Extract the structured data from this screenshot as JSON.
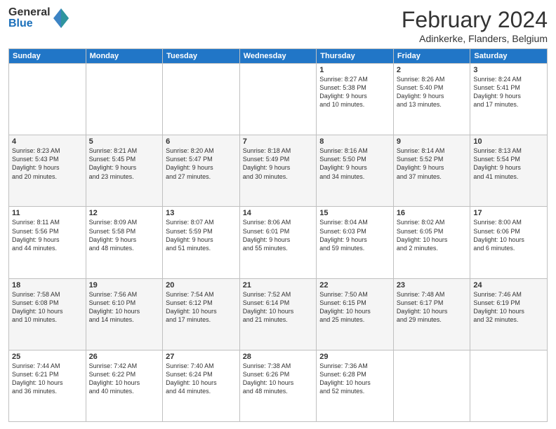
{
  "header": {
    "logo": {
      "general": "General",
      "blue": "Blue"
    },
    "title": "February 2024",
    "location": "Adinkerke, Flanders, Belgium"
  },
  "weekdays": [
    "Sunday",
    "Monday",
    "Tuesday",
    "Wednesday",
    "Thursday",
    "Friday",
    "Saturday"
  ],
  "weeks": [
    [
      {
        "day": "",
        "info": ""
      },
      {
        "day": "",
        "info": ""
      },
      {
        "day": "",
        "info": ""
      },
      {
        "day": "",
        "info": ""
      },
      {
        "day": "1",
        "info": "Sunrise: 8:27 AM\nSunset: 5:38 PM\nDaylight: 9 hours\nand 10 minutes."
      },
      {
        "day": "2",
        "info": "Sunrise: 8:26 AM\nSunset: 5:40 PM\nDaylight: 9 hours\nand 13 minutes."
      },
      {
        "day": "3",
        "info": "Sunrise: 8:24 AM\nSunset: 5:41 PM\nDaylight: 9 hours\nand 17 minutes."
      }
    ],
    [
      {
        "day": "4",
        "info": "Sunrise: 8:23 AM\nSunset: 5:43 PM\nDaylight: 9 hours\nand 20 minutes."
      },
      {
        "day": "5",
        "info": "Sunrise: 8:21 AM\nSunset: 5:45 PM\nDaylight: 9 hours\nand 23 minutes."
      },
      {
        "day": "6",
        "info": "Sunrise: 8:20 AM\nSunset: 5:47 PM\nDaylight: 9 hours\nand 27 minutes."
      },
      {
        "day": "7",
        "info": "Sunrise: 8:18 AM\nSunset: 5:49 PM\nDaylight: 9 hours\nand 30 minutes."
      },
      {
        "day": "8",
        "info": "Sunrise: 8:16 AM\nSunset: 5:50 PM\nDaylight: 9 hours\nand 34 minutes."
      },
      {
        "day": "9",
        "info": "Sunrise: 8:14 AM\nSunset: 5:52 PM\nDaylight: 9 hours\nand 37 minutes."
      },
      {
        "day": "10",
        "info": "Sunrise: 8:13 AM\nSunset: 5:54 PM\nDaylight: 9 hours\nand 41 minutes."
      }
    ],
    [
      {
        "day": "11",
        "info": "Sunrise: 8:11 AM\nSunset: 5:56 PM\nDaylight: 9 hours\nand 44 minutes."
      },
      {
        "day": "12",
        "info": "Sunrise: 8:09 AM\nSunset: 5:58 PM\nDaylight: 9 hours\nand 48 minutes."
      },
      {
        "day": "13",
        "info": "Sunrise: 8:07 AM\nSunset: 5:59 PM\nDaylight: 9 hours\nand 51 minutes."
      },
      {
        "day": "14",
        "info": "Sunrise: 8:06 AM\nSunset: 6:01 PM\nDaylight: 9 hours\nand 55 minutes."
      },
      {
        "day": "15",
        "info": "Sunrise: 8:04 AM\nSunset: 6:03 PM\nDaylight: 9 hours\nand 59 minutes."
      },
      {
        "day": "16",
        "info": "Sunrise: 8:02 AM\nSunset: 6:05 PM\nDaylight: 10 hours\nand 2 minutes."
      },
      {
        "day": "17",
        "info": "Sunrise: 8:00 AM\nSunset: 6:06 PM\nDaylight: 10 hours\nand 6 minutes."
      }
    ],
    [
      {
        "day": "18",
        "info": "Sunrise: 7:58 AM\nSunset: 6:08 PM\nDaylight: 10 hours\nand 10 minutes."
      },
      {
        "day": "19",
        "info": "Sunrise: 7:56 AM\nSunset: 6:10 PM\nDaylight: 10 hours\nand 14 minutes."
      },
      {
        "day": "20",
        "info": "Sunrise: 7:54 AM\nSunset: 6:12 PM\nDaylight: 10 hours\nand 17 minutes."
      },
      {
        "day": "21",
        "info": "Sunrise: 7:52 AM\nSunset: 6:14 PM\nDaylight: 10 hours\nand 21 minutes."
      },
      {
        "day": "22",
        "info": "Sunrise: 7:50 AM\nSunset: 6:15 PM\nDaylight: 10 hours\nand 25 minutes."
      },
      {
        "day": "23",
        "info": "Sunrise: 7:48 AM\nSunset: 6:17 PM\nDaylight: 10 hours\nand 29 minutes."
      },
      {
        "day": "24",
        "info": "Sunrise: 7:46 AM\nSunset: 6:19 PM\nDaylight: 10 hours\nand 32 minutes."
      }
    ],
    [
      {
        "day": "25",
        "info": "Sunrise: 7:44 AM\nSunset: 6:21 PM\nDaylight: 10 hours\nand 36 minutes."
      },
      {
        "day": "26",
        "info": "Sunrise: 7:42 AM\nSunset: 6:22 PM\nDaylight: 10 hours\nand 40 minutes."
      },
      {
        "day": "27",
        "info": "Sunrise: 7:40 AM\nSunset: 6:24 PM\nDaylight: 10 hours\nand 44 minutes."
      },
      {
        "day": "28",
        "info": "Sunrise: 7:38 AM\nSunset: 6:26 PM\nDaylight: 10 hours\nand 48 minutes."
      },
      {
        "day": "29",
        "info": "Sunrise: 7:36 AM\nSunset: 6:28 PM\nDaylight: 10 hours\nand 52 minutes."
      },
      {
        "day": "",
        "info": ""
      },
      {
        "day": "",
        "info": ""
      }
    ]
  ]
}
